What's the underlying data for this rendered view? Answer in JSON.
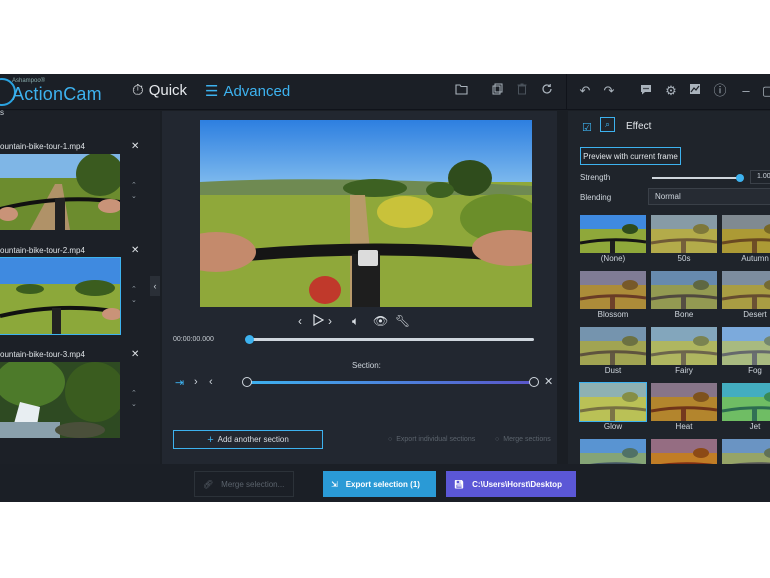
{
  "app": {
    "brand_small": "Ashampoo®",
    "brand_name": "ActionCam"
  },
  "modes": {
    "quick": "Quick",
    "advanced": "Advanced"
  },
  "toolbar_icons": [
    "folder-icon",
    "copy-icon",
    "delete-icon",
    "rotate-icon",
    "undo-icon",
    "redo-icon",
    "feedback-icon",
    "settings-icon",
    "chart-icon",
    "info-icon",
    "minimize-icon",
    "maximize-icon"
  ],
  "left_panel_header": "s",
  "clips": [
    {
      "name": "ountain-bike-tour-1.mp4"
    },
    {
      "name": "ountain-bike-tour-2.mp4"
    },
    {
      "name": "ountain-bike-tour-3.mp4"
    }
  ],
  "player": {
    "timecode": "00:00:00.000",
    "position": 0
  },
  "section": {
    "label": "Section:",
    "add_button": "Add another section",
    "export_individual": "Export individual sections",
    "merge": "Merge sections"
  },
  "effect_panel": {
    "title": "Effect",
    "preview_button": "Preview with current frame",
    "strength_label": "Strength",
    "strength_value": "1.00",
    "blending_label": "Blending",
    "blending_value": "Normal",
    "effects": [
      "(None)",
      "50s",
      "Autumn",
      "Blossom",
      "Bone",
      "Desert",
      "Dust",
      "Fairy",
      "Fog",
      "Glow",
      "Heat",
      "Jet",
      "",
      "",
      ""
    ],
    "selected": "Glow"
  },
  "bottom": {
    "merge_selection": "Merge selection...",
    "export_selection": "Export selection (1)",
    "path": "C:\\Users\\Horst\\Desktop"
  },
  "colors": {
    "accent": "#3db2ef",
    "export_button": "#2a9ad6",
    "path_button": "#5b57d6",
    "background": "#1a1e24"
  }
}
